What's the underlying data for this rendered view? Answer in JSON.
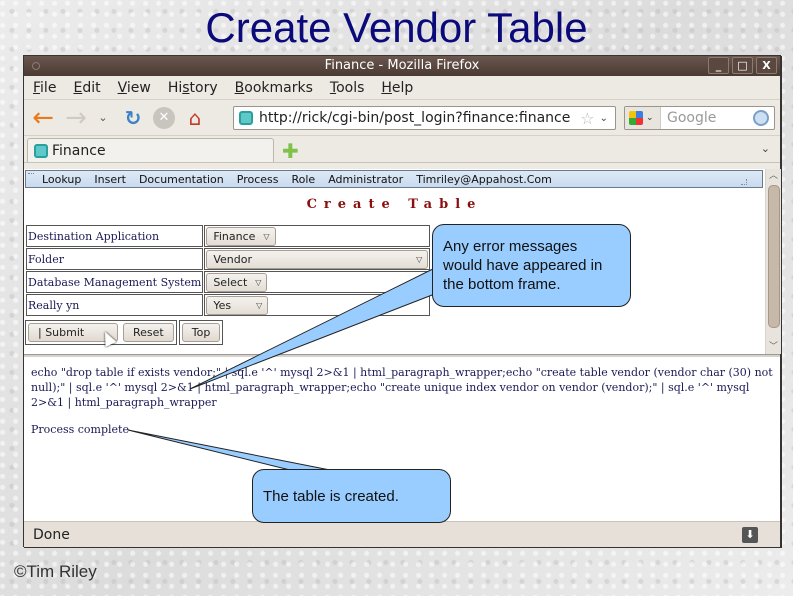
{
  "slide": {
    "title": "Create Vendor Table",
    "copyright": "©Tim Riley"
  },
  "window": {
    "title": "Finance - Mozilla Firefox",
    "controls": {
      "minimize": "_",
      "maximize": "□",
      "close": "X"
    }
  },
  "menubar": {
    "items": [
      {
        "label": "File",
        "accel": "F"
      },
      {
        "label": "Edit",
        "accel": "E"
      },
      {
        "label": "View",
        "accel": "V"
      },
      {
        "label": "History",
        "accel": "s"
      },
      {
        "label": "Bookmarks",
        "accel": "B"
      },
      {
        "label": "Tools",
        "accel": "T"
      },
      {
        "label": "Help",
        "accel": "H"
      }
    ]
  },
  "navbar": {
    "url": "http://rick/cgi-bin/post_login?finance:finance",
    "search_placeholder": "Google",
    "icons": {
      "back": "←",
      "forward": "→",
      "history": "⌄",
      "reload": "↻",
      "stop": "✕",
      "home": "⌂",
      "star": "☆",
      "dropdown": "⌄",
      "search_engine_caret": "⌄"
    }
  },
  "tabs": {
    "active_label": "Finance",
    "new_tab": "✚",
    "list": "⌄"
  },
  "app_menu": {
    "items": [
      "Lookup",
      "Insert",
      "Documentation",
      "Process",
      "Role",
      "Administrator",
      "Timriley@Appahost.Com"
    ]
  },
  "form": {
    "heading": "Create Table",
    "rows": [
      {
        "label": "Destination Application",
        "value": "Finance"
      },
      {
        "label": "Folder",
        "value": "Vendor"
      },
      {
        "label": "Database Management System",
        "value": "Select"
      },
      {
        "label": "Really yn",
        "value": "Yes"
      }
    ],
    "buttons": {
      "submit": "|   Submit",
      "reset": "Reset",
      "top": "Top"
    }
  },
  "output": {
    "command": "echo \"drop table if exists vendor;\" | sql.e '^' mysql 2>&1 | html_paragraph_wrapper;echo \"create table vendor (vendor char (30) not null);\" | sql.e '^' mysql 2>&1 | html_paragraph_wrapper;echo \"create unique index vendor on vendor (vendor);\" | sql.e '^' mysql 2>&1 | html_paragraph_wrapper",
    "status": "Process complete"
  },
  "statusbar": {
    "text": "Done",
    "download_icon": "⬇"
  },
  "callouts": {
    "error_note": "Any error messages would have appeared in the bottom frame.",
    "created_note": "The table is created."
  },
  "colors": {
    "title": "#0a0a7a",
    "heading": "#8a1010",
    "callout_fill": "#99ccff",
    "titlebar": "#4a3a33"
  }
}
